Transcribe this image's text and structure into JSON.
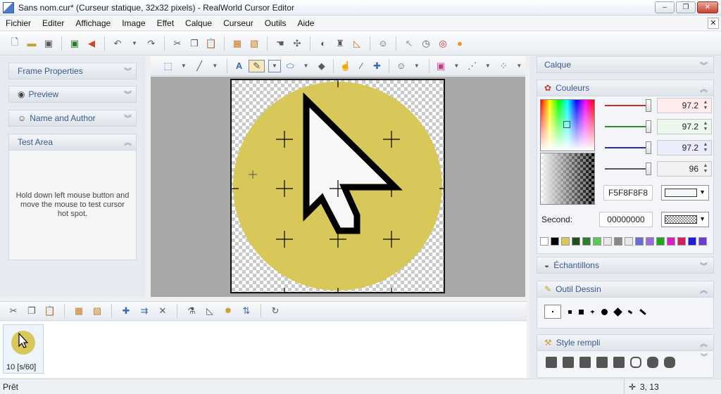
{
  "window": {
    "title": "Sans nom.cur* (Curseur statique, 32x32 pixels) - RealWorld Cursor Editor",
    "controls": {
      "minimize": "–",
      "maximize": "❐",
      "close": "✕"
    }
  },
  "menu": {
    "items": [
      "Fichier",
      "Editer",
      "Affichage",
      "Image",
      "Effet",
      "Calque",
      "Curseur",
      "Outils",
      "Aide"
    ],
    "close_doc": "✕"
  },
  "left_panel": {
    "sections": [
      {
        "label": "Frame Properties",
        "icon": ""
      },
      {
        "label": "Preview",
        "icon": "eye-icon"
      },
      {
        "label": "Name and Author",
        "icon": "user-icon"
      },
      {
        "label": "Test Area",
        "icon": ""
      }
    ],
    "test_area_text": "Hold down left mouse button and move the mouse to test cursor hot spot."
  },
  "frames": {
    "frame_label": "10 [s/60]"
  },
  "right_panel": {
    "calque": "Calque",
    "couleurs": "Couleurs",
    "sliders": [
      {
        "value": "97.2",
        "color": "#c03030",
        "field_bg": "#fdeceb"
      },
      {
        "value": "97.2",
        "color": "#2c8a2c",
        "field_bg": "#ebf7ea"
      },
      {
        "value": "97.2",
        "color": "#2a2ab0",
        "field_bg": "#ecebfb"
      },
      {
        "value": "96",
        "color": "#555555",
        "field_bg": "#f1f1f1"
      }
    ],
    "hex_value": "F5F8F8F8",
    "second_label": "Second:",
    "second_value": "00000000",
    "palette": [
      "#ffffff",
      "#000000",
      "#d8c85a",
      "#1e4d1e",
      "#2e7d2e",
      "#5bc85b",
      "#e8e8e8",
      "#888888",
      "#e8e8e8",
      "#6b6bd8",
      "#9b6bd8",
      "#1ea81e",
      "#d81ec8",
      "#d81e5b",
      "#1e1ed8",
      "#6b3ad8"
    ],
    "echantillons": "Échantillons",
    "outil_dessin": "Outil Dessin",
    "style_rempli": "Style rempli"
  },
  "status": {
    "left": "Prêt",
    "coords": "3, 13"
  },
  "colors": {
    "accent_text": "#3a5a8c",
    "cursor_bg_yellow": "#d8c85a"
  }
}
